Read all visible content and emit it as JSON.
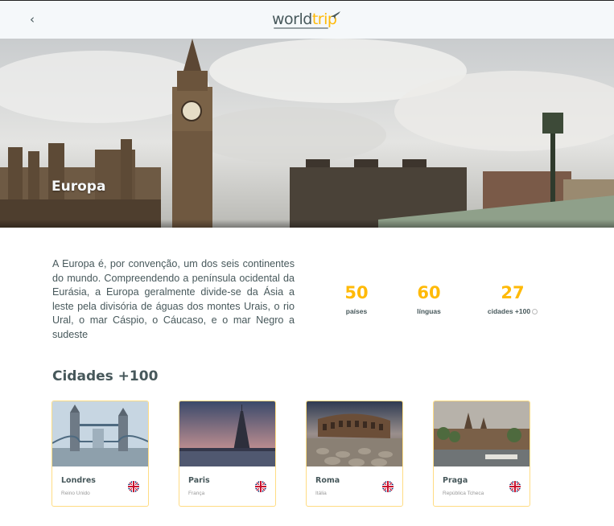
{
  "header": {
    "back_icon": "chevron-left-icon",
    "logo_word": "world",
    "logo_trip": "trip",
    "logo_icon": "airplane-icon"
  },
  "banner": {
    "title": "Europa"
  },
  "continent": {
    "description": "A Europa é, por convenção, um dos seis continentes do mundo. Compreendendo a península ocidental da Eurásia, a Europa geralmente divide-se da Ásia a leste pela divisória de águas dos montes Urais, o rio Ural, o mar Cáspio, o Cáucaso, e o mar Negro a sudeste"
  },
  "stats": [
    {
      "value": "50",
      "label": "países"
    },
    {
      "value": "60",
      "label": "línguas"
    },
    {
      "value": "27",
      "label": "cidades +100",
      "icon": "info-icon"
    }
  ],
  "cities_section": {
    "title": "Cidades +100"
  },
  "cities": [
    {
      "name": "Londres",
      "country": "Reino Unido",
      "flag_icon": "uk-flag-icon"
    },
    {
      "name": "Paris",
      "country": "França",
      "flag_icon": "uk-flag-icon"
    },
    {
      "name": "Roma",
      "country": "Itália",
      "flag_icon": "uk-flag-icon"
    },
    {
      "name": "Praga",
      "country": "República Tcheca",
      "flag_icon": "uk-flag-icon"
    }
  ],
  "colors": {
    "accent": "#FFBA08",
    "text": "#47585B",
    "header_bg": "#F5F8FA"
  }
}
